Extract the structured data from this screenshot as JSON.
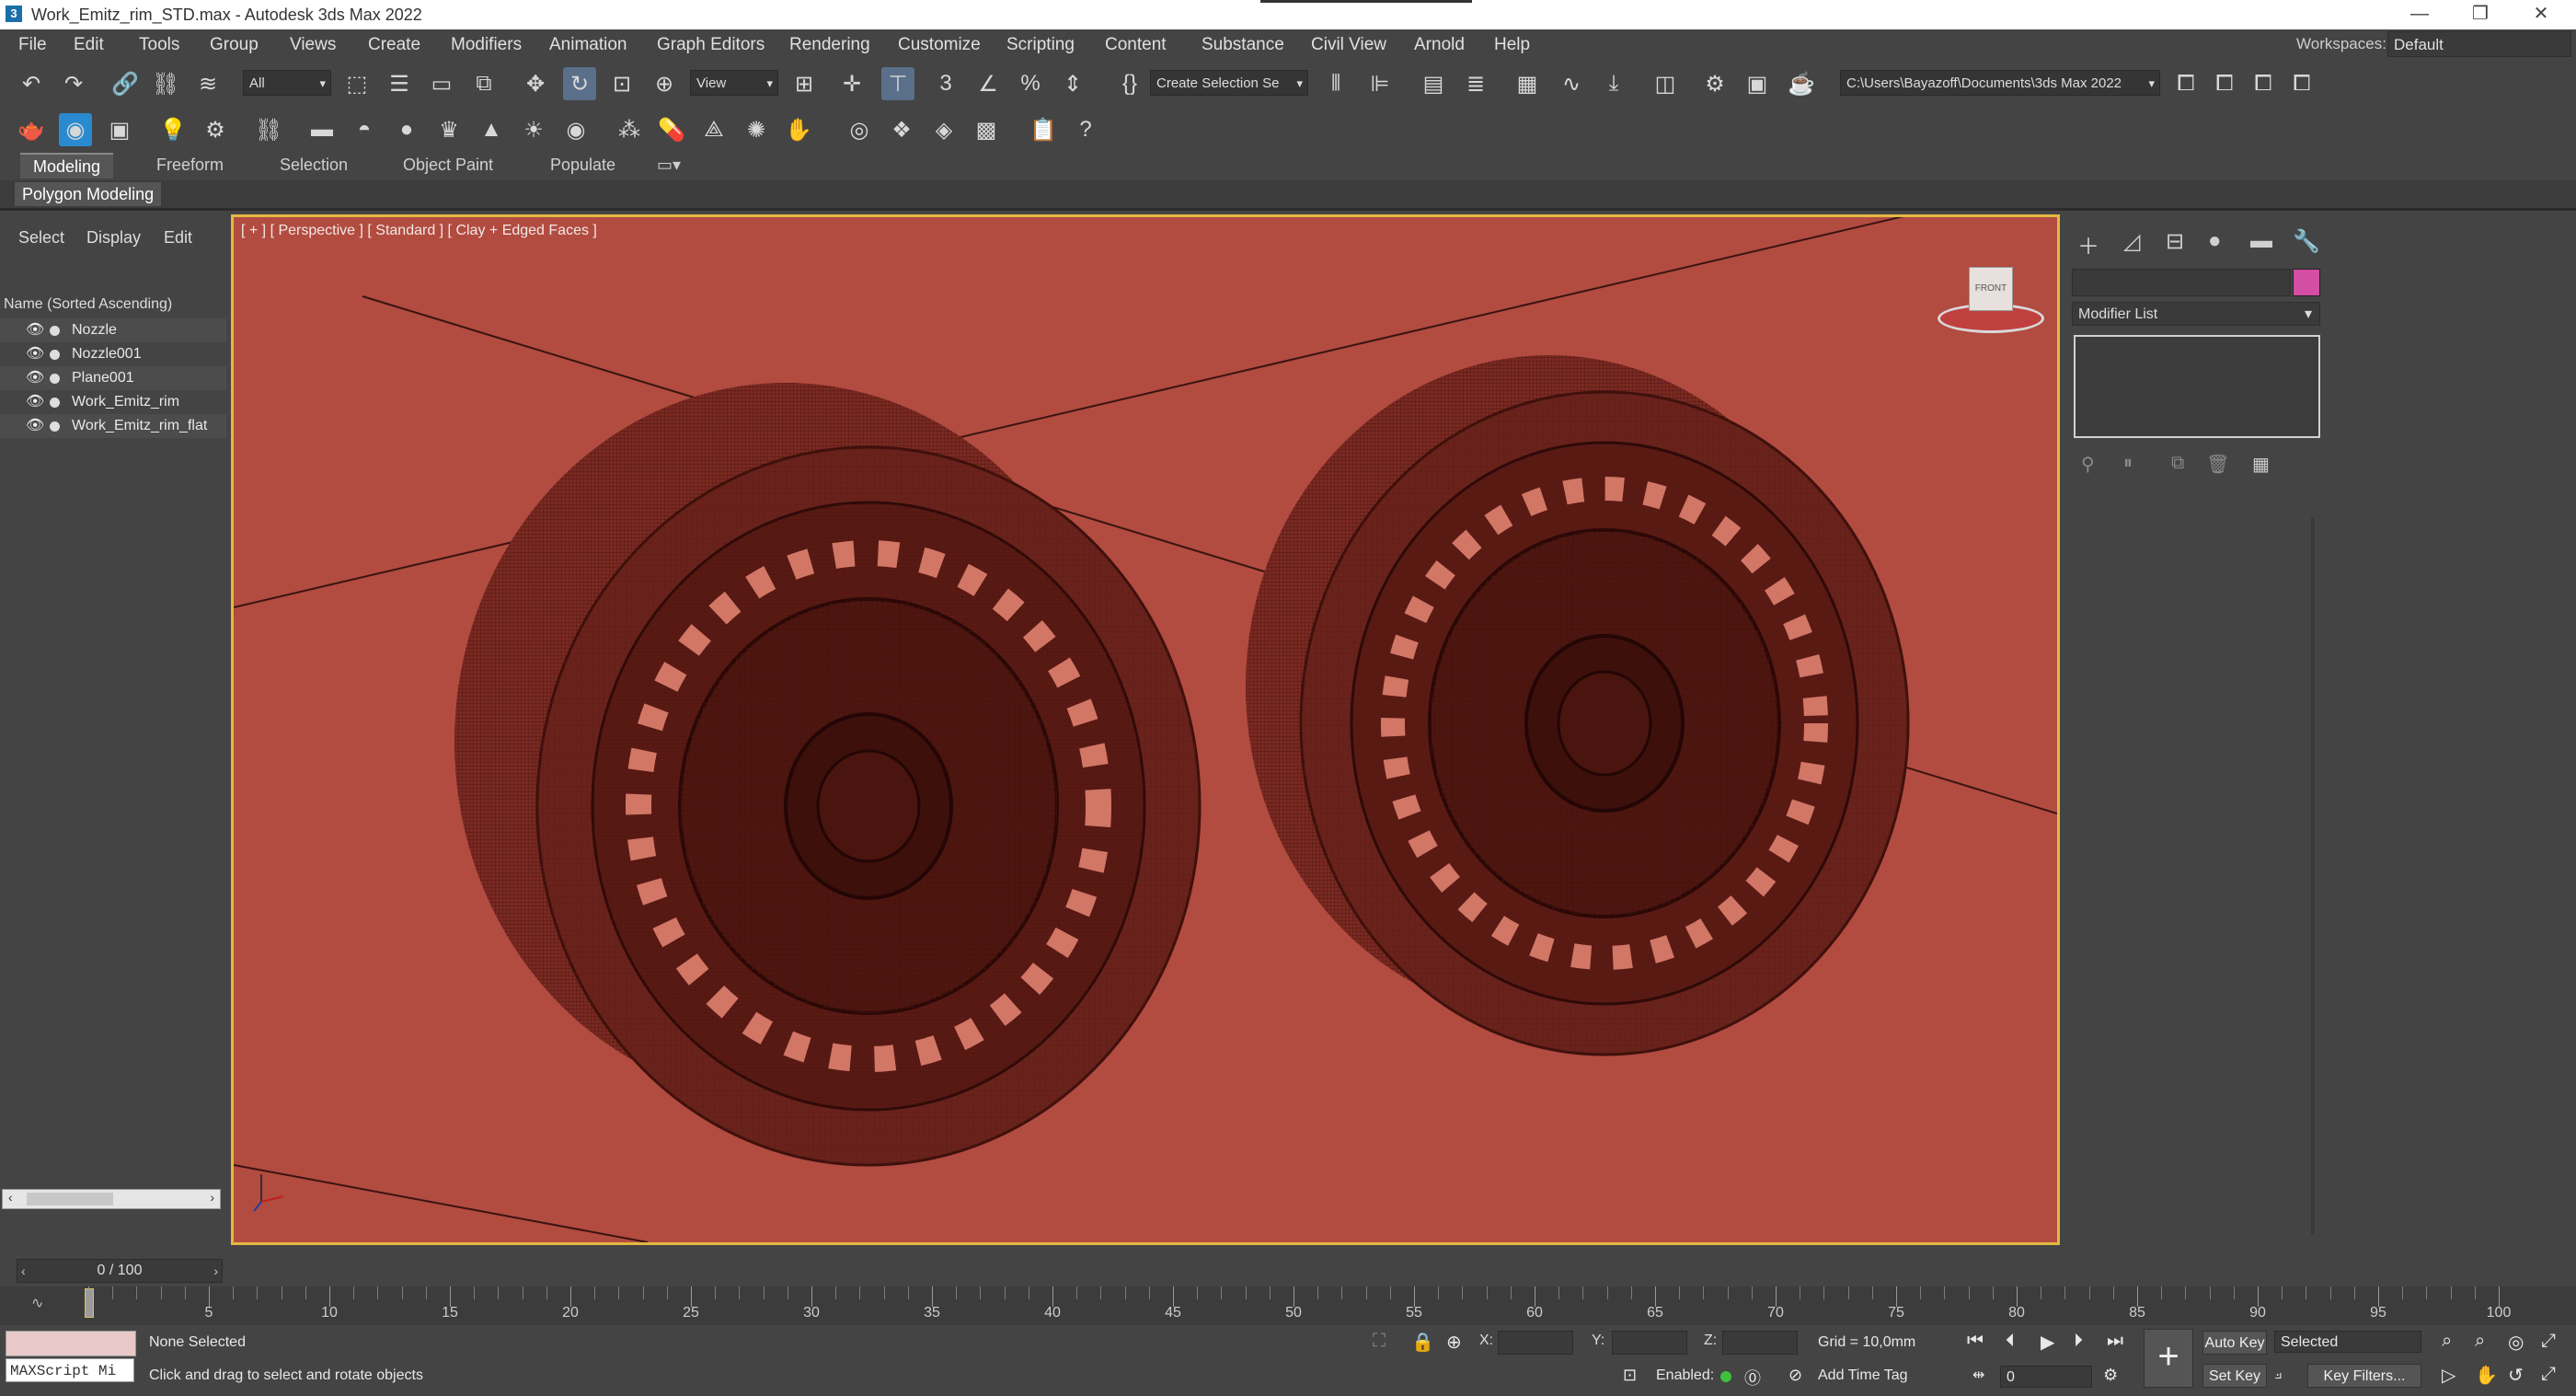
{
  "window": {
    "title": "Work_Emitz_rim_STD.max - Autodesk 3ds Max 2022",
    "app_icon": "3",
    "minimize": "—",
    "restore": "❐",
    "close": "✕"
  },
  "menu": [
    "File",
    "Edit",
    "Tools",
    "Group",
    "Views",
    "Create",
    "Modifiers",
    "Animation",
    "Graph Editors",
    "Rendering",
    "Customize",
    "Scripting",
    "Content",
    "Substance",
    "Civil View",
    "Arnold",
    "Help"
  ],
  "workspaces": {
    "label": "Workspaces:",
    "value": "Default"
  },
  "main_toolbar": {
    "selection_filter": "All",
    "ref_coord": "View",
    "named_selection": "Create Selection Se",
    "project_path": "C:\\Users\\Bayazoff\\Documents\\3ds Max 2022"
  },
  "ribbon": {
    "tabs": [
      "Modeling",
      "Freeform",
      "Selection",
      "Object Paint",
      "Populate"
    ],
    "active_tab": "Modeling",
    "panel_label": "Polygon Modeling"
  },
  "scene_explorer": {
    "tabs": [
      "Select",
      "Display",
      "Edit"
    ],
    "column_header": "Name (Sorted Ascending)",
    "items": [
      "Nozzle",
      "Nozzle001",
      "Plane001",
      "Work_Emitz_rim",
      "Work_Emitz_rim_flat"
    ]
  },
  "viewport": {
    "label": "[ + ] [ Perspective ] [ Standard ] [ Clay + Edged Faces ]",
    "background": "#b24b40",
    "viewcube_label": "FRONT"
  },
  "command_panel": {
    "modifier_list": "Modifier List",
    "object_color": "#d44ea4"
  },
  "timeline": {
    "frame_display": "0 / 100",
    "ticks": [
      5,
      10,
      15,
      20,
      25,
      30,
      35,
      40,
      45,
      50,
      55,
      60,
      65,
      70,
      75,
      80,
      85,
      90,
      95,
      100
    ]
  },
  "status": {
    "maxscript_placeholder": "MAXScript Mi",
    "selection_status": "None Selected",
    "prompt": "Click and drag to select and rotate objects",
    "x_label": "X:",
    "y_label": "Y:",
    "z_label": "Z:",
    "grid": "Grid = 10,0mm",
    "enabled_label": "Enabled:",
    "add_time_tag": "Add Time Tag",
    "current_frame": "0",
    "auto_key": "Auto Key",
    "set_key": "Set Key",
    "key_mode": "Selected",
    "key_filters": "Key Filters..."
  }
}
